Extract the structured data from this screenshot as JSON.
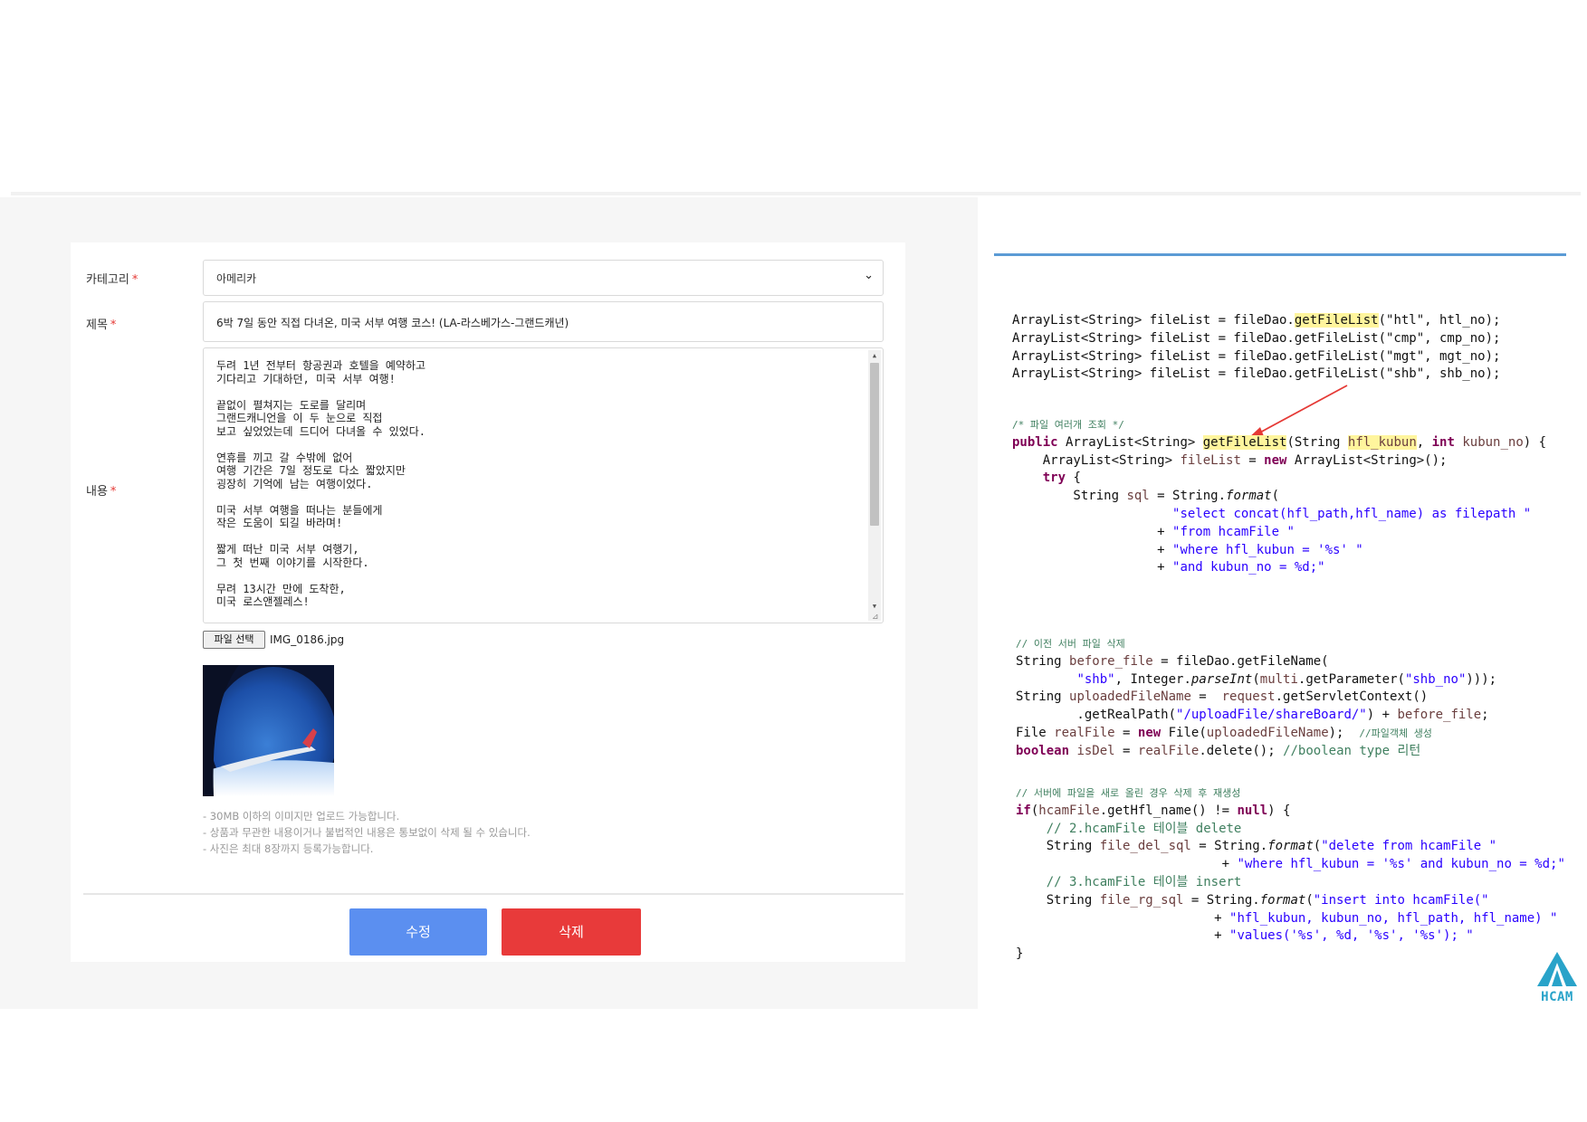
{
  "form": {
    "category_label": "카테고리",
    "required_mark": "*",
    "category_value": "아메리카",
    "title_label": "제목",
    "title_value": "6박 7일 동안 직접 다녀온, 미국 서부 여행 코스! (LA-라스베가스-그랜드캐년)",
    "content_label": "내용",
    "content_paragraphs": [
      "두려 1년 전부터 항공권과 호텔을 예약하고\n기다리고 기대하던, 미국 서부 여행!",
      "끝없이 펼쳐지는 도로를 달리며\n그랜드캐니언을 이 두 눈으로 직접\n보고 싶었었는데 드디어 다녀올 수 있었다.",
      "연휴를 끼고 갈 수밖에 없어\n여행 기간은 7일 정도로 다소 짧았지만\n굉장히 기억에 남는 여행이었다.",
      "미국 서부 여행을 떠나는 분들에게\n작은 도움이 되길 바라며!",
      "짧게 떠난 미국 서부 여행기,\n그 첫 번째 이야기를 시작한다.",
      "무려 13시간 만에 도착한,\n미국 로스앤젤레스!"
    ],
    "file_button": "파일 선택",
    "file_name": "IMG_0186.jpg",
    "notes": [
      "- 30MB 이하의 이미지만 업로드 가능합니다.",
      "- 상품과 무관한 내용이거나 불법적인 내용은 통보없이 삭제 될 수 있습니다.",
      "- 사진은 최대 8장까지 등록가능합니다."
    ],
    "edit_button": "수정",
    "delete_button": "삭제"
  },
  "code": {
    "lines1": [
      "ArrayList<String> fileList = fileDao.",
      "getFileList",
      "(\"htl\", htl_no);",
      "ArrayList<String> fileList = fileDao.getFileList(\"cmp\", cmp_no);",
      "ArrayList<String> fileList = fileDao.getFileList(\"mgt\", mgt_no);",
      "ArrayList<String> fileList = fileDao.getFileList(\"shb\", shb_no);"
    ],
    "comment_multi": "/* 파일 여러개 조회 */",
    "comment_delete_server": "// 이전 서버 파일 삭제",
    "comment_upload": "// 서버에 파일을 새로 올린 경우 삭제 후 재생성",
    "comment_step2": "// 2.hcamFile 테이블 delete",
    "comment_step3": "// 3.hcamFile 테이블 insert",
    "comment_file_obj": "//파일객체 생성",
    "comment_bool": "//boolean type 리턴"
  },
  "logo": {
    "text": "HCAM"
  },
  "colors": {
    "edit_button": "#5b8ff0",
    "delete_button": "#e83a3a",
    "accent_rule": "#5b9bd5",
    "arrow": "#e53935"
  }
}
